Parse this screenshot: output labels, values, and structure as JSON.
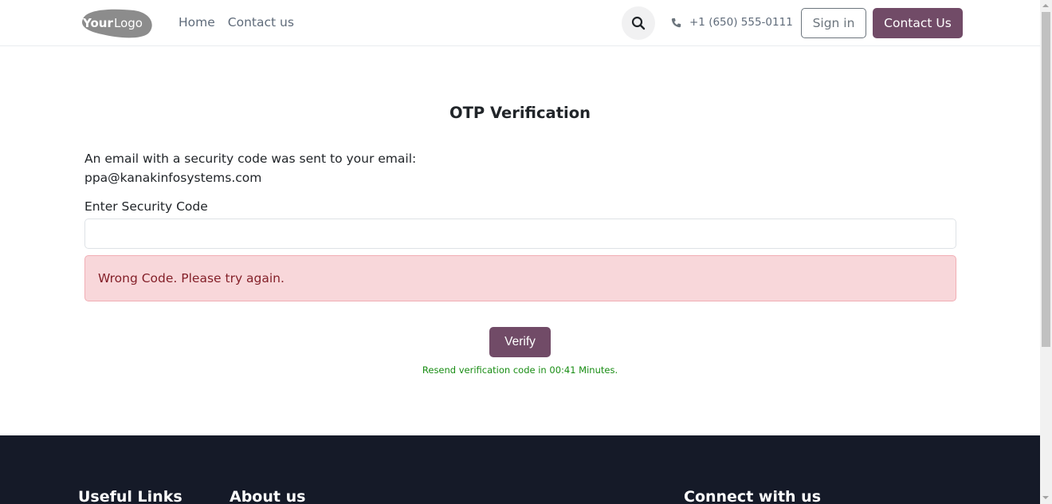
{
  "header": {
    "logo_text_bold": "Your",
    "logo_text_light": "Logo",
    "nav": [
      {
        "label": "Home"
      },
      {
        "label": "Contact us"
      }
    ],
    "search_icon": "search-icon",
    "phone_icon": "phone-icon",
    "phone": "+1 (650) 555-0111",
    "signin_label": "Sign in",
    "contact_label": "Contact Us"
  },
  "main": {
    "title": "OTP Verification",
    "message": "An email with a security code was sent to your email:",
    "email": "ppa@kanakinfosystems.com",
    "code_label": "Enter Security Code",
    "code_value": "",
    "error": "Wrong Code. Please try again.",
    "verify_label": "Verify",
    "resend_text": "Resend verification code in 00:41 Minutes."
  },
  "footer": {
    "headings": [
      "Useful Links",
      "About us",
      "Connect with us"
    ]
  },
  "colors": {
    "brand": "#714b67",
    "footer_bg": "#151a28",
    "alert_bg": "#f8d7da",
    "alert_text": "#842029",
    "resend_text": "#198d14"
  }
}
